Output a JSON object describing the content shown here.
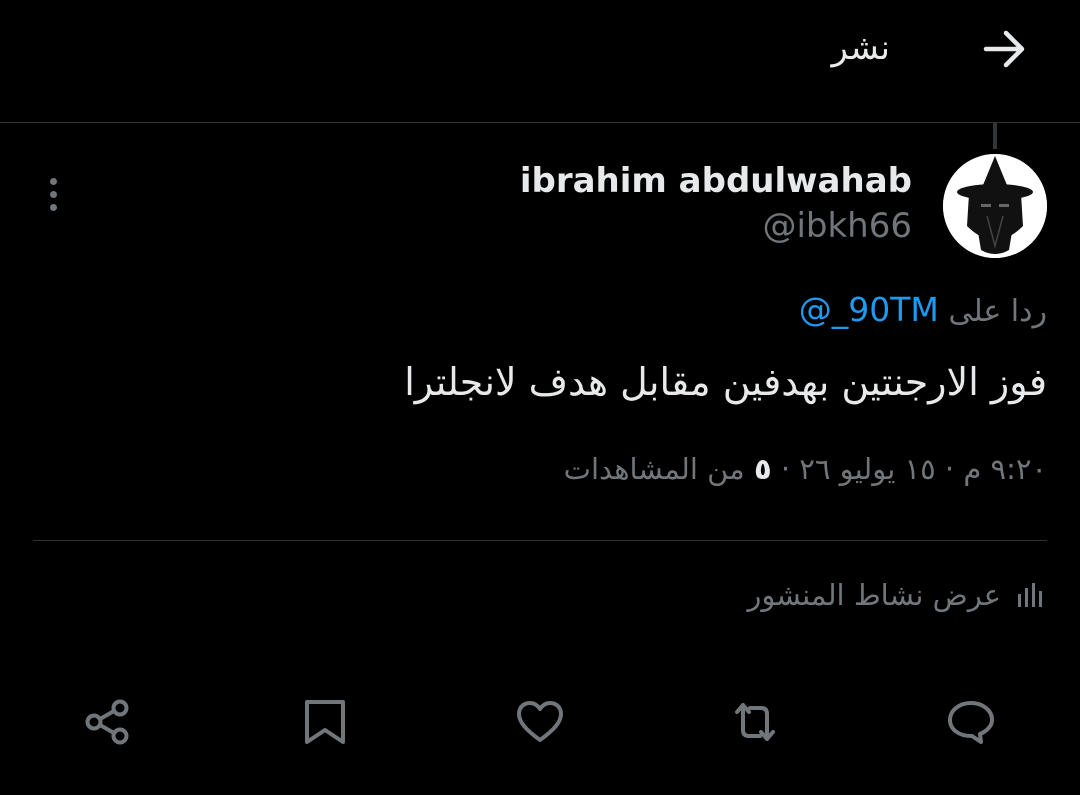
{
  "header": {
    "title": "نشر",
    "back_icon": "arrow-right-icon"
  },
  "post": {
    "author_name": "ibrahim abdulwahab",
    "author_handle": "@ibkh66",
    "avatar_icon": "wizard-avatar",
    "more_icon": "more-vertical-icon",
    "reply_prefix": "ردا على",
    "reply_to": "@_90TM",
    "text": "فوز الارجنتين بهدفين مقابل هدف لانجلترا",
    "timestamp": "٩:٢٠ م · ١٥ يوليو ٢٦",
    "views_count": "٥",
    "views_label": "من المشاهدات"
  },
  "activity": {
    "label": "عرض نشاط المنشور",
    "icon": "analytics-icon"
  },
  "actions": {
    "reply_icon": "reply-icon",
    "repost_icon": "repost-icon",
    "like_icon": "heart-icon",
    "bookmark_icon": "bookmark-icon",
    "share_icon": "share-icon"
  },
  "colors": {
    "background": "#000000",
    "primary_text": "#e7e9ea",
    "secondary_text": "#71767b",
    "accent": "#1d9bf0",
    "divider": "#2f3336"
  }
}
